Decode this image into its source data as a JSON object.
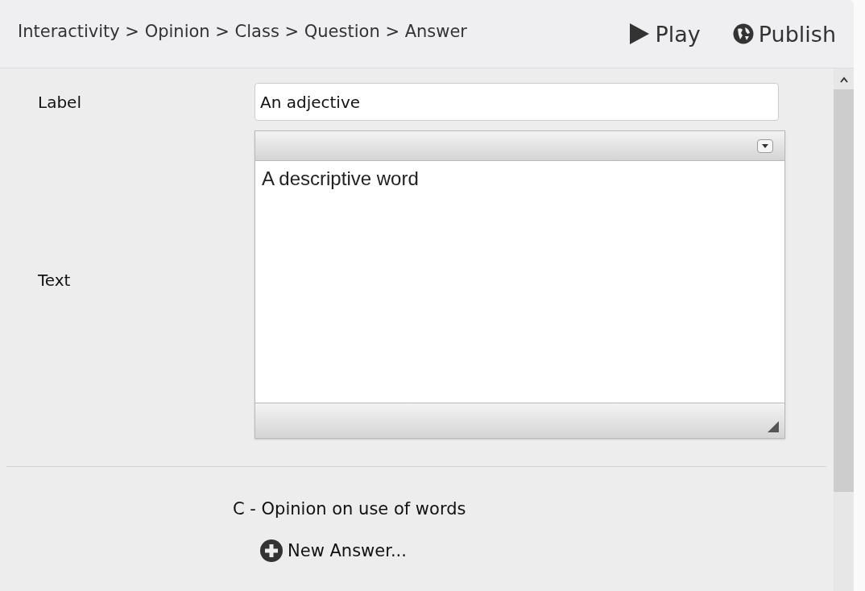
{
  "header": {
    "breadcrumb": "Interactivity > Opinion > Class > Question > Answer",
    "actions": [
      {
        "kind": "play",
        "label": "Play"
      },
      {
        "kind": "publish",
        "label": "Publish"
      }
    ]
  },
  "form": {
    "label_field": {
      "label": "Label",
      "value": "An adjective"
    },
    "text_field": {
      "label": "Text",
      "value": "A descriptive word"
    }
  },
  "section": {
    "title": "C - Opinion on use of words",
    "new_button": "New Answer..."
  }
}
